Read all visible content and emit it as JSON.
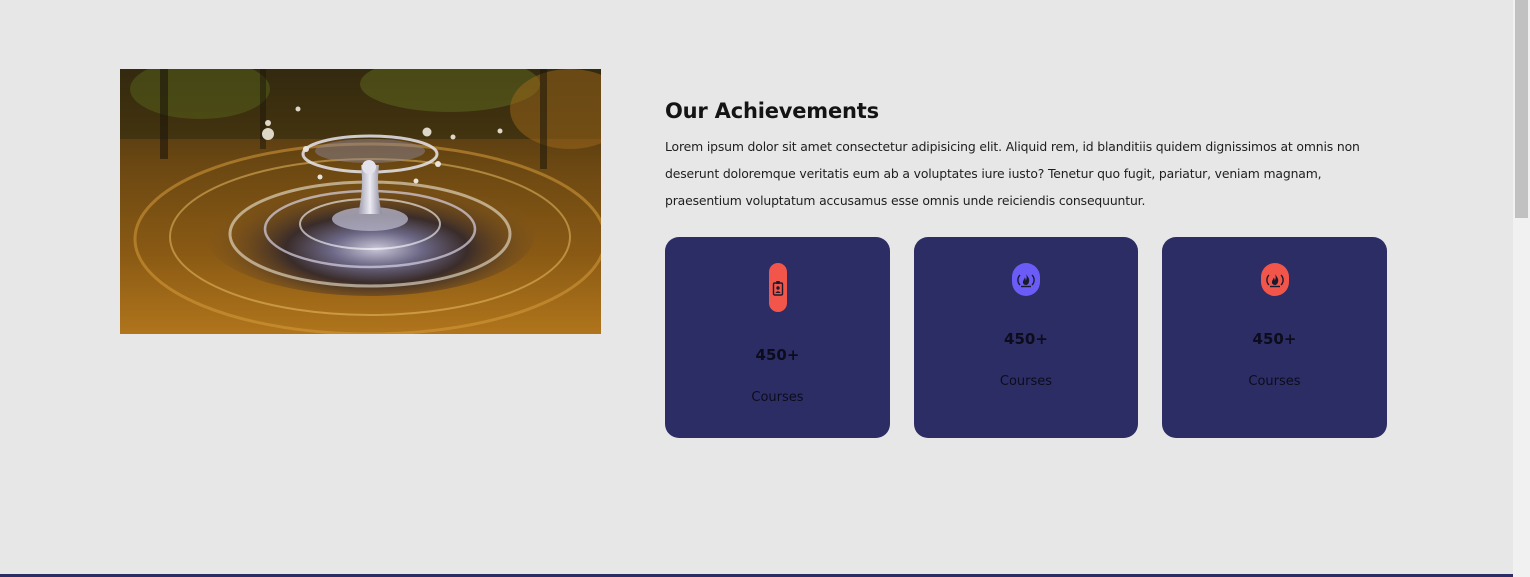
{
  "section": {
    "title": "Our Achievements",
    "description": "Lorem ipsum dolor sit amet consectetur adipisicing elit. Aliquid rem, id blanditiis quidem dignissimos at omnis non deserunt doloremque veritatis eum ab a voluptates iure iusto? Tenetur quo fugit, pariatur, veniam magnam, praesentium voluptatum accusamus esse omnis unde reiciendis consequuntur."
  },
  "image": {
    "icon": "water-drop-splash-photo"
  },
  "stats": [
    {
      "value": "450+",
      "label": "Courses",
      "icon": "id-badge-icon",
      "icon_color": "#f2564a"
    },
    {
      "value": "450+",
      "label": "Courses",
      "icon": "fire-icon",
      "icon_color": "#6b5cf7"
    },
    {
      "value": "450+",
      "label": "Courses",
      "icon": "fire-icon",
      "icon_color": "#f2564a"
    }
  ],
  "colors": {
    "background": "#e7e7e7",
    "card": "#2d2d66",
    "accent_red": "#f2564a",
    "accent_purple": "#6b5cf7"
  }
}
